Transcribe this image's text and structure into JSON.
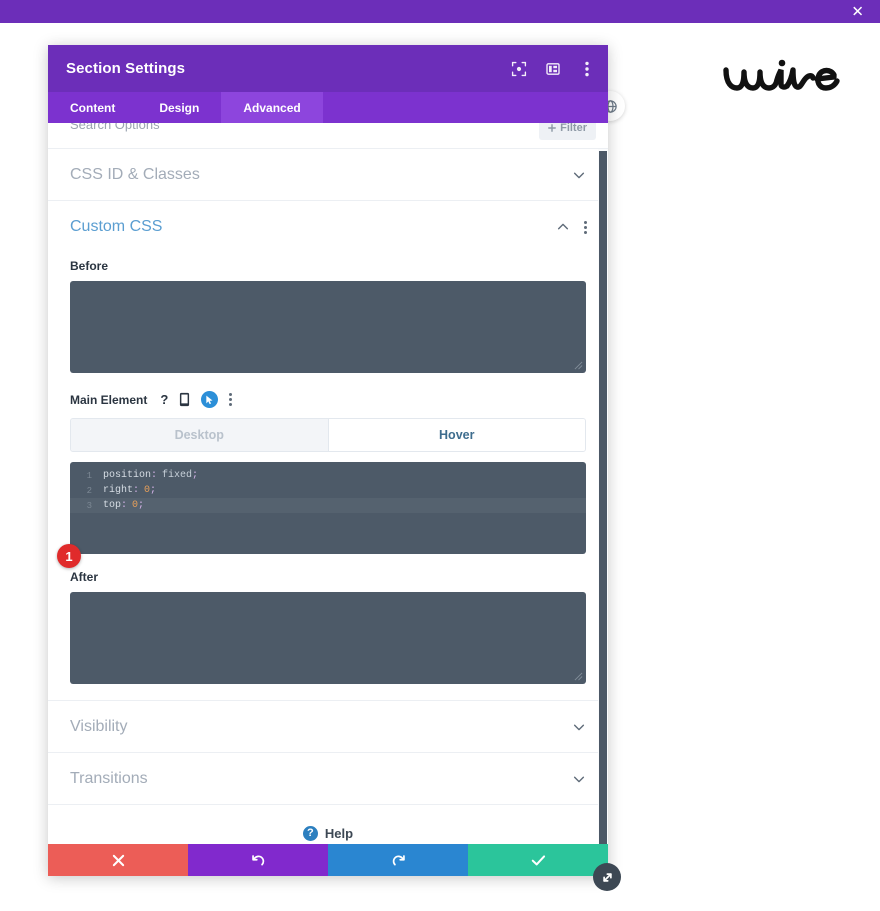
{
  "topbar": {
    "close_label": "✕",
    "background": "#6c2eb9"
  },
  "brand": {
    "logo_text": "wire"
  },
  "modal": {
    "title": "Section Settings",
    "header_icons": [
      {
        "name": "focus-target-icon",
        "label": "focus"
      },
      {
        "name": "layout-panel-icon",
        "label": "layout"
      },
      {
        "name": "more-vertical-icon",
        "label": "more"
      }
    ],
    "tabs": [
      {
        "label": "Content",
        "active": false
      },
      {
        "label": "Design",
        "active": false
      },
      {
        "label": "Advanced",
        "active": true
      }
    ],
    "search": {
      "placeholder": "Search Options",
      "filter_label": "Filter"
    },
    "sections": [
      {
        "label": "CSS ID & Classes",
        "expanded": false
      },
      {
        "label": "Custom CSS",
        "expanded": true
      },
      {
        "label": "Visibility",
        "expanded": false
      },
      {
        "label": "Transitions",
        "expanded": false
      }
    ],
    "custom_css": {
      "title": "Custom CSS",
      "before_label": "Before",
      "before_value": "",
      "after_label": "After",
      "after_value": "",
      "main_element_label": "Main Element",
      "state_tabs": [
        {
          "label": "Desktop",
          "active": false
        },
        {
          "label": "Hover",
          "active": true
        }
      ],
      "code_lines": [
        {
          "number": "1",
          "property": "position",
          "colon": ":",
          "value": "fixed",
          "value_type": "keyword",
          "semicolon": ";",
          "highlighted": false
        },
        {
          "number": "2",
          "property": "right",
          "colon": ":",
          "value": "0",
          "value_type": "number",
          "semicolon": ";",
          "highlighted": false
        },
        {
          "number": "3",
          "property": "top",
          "colon": ":",
          "value": "0",
          "value_type": "number",
          "semicolon": ";",
          "highlighted": true
        }
      ]
    },
    "step_badge": "1",
    "help": {
      "icon_glyph": "?",
      "label": "Help"
    },
    "actions": [
      {
        "name": "cancel-button",
        "glyph": "✖",
        "color": "#ec5d57"
      },
      {
        "name": "undo-button",
        "glyph": "↺",
        "color": "#8129cd"
      },
      {
        "name": "redo-button",
        "glyph": "↻",
        "color": "#2a86d1"
      },
      {
        "name": "save-button",
        "glyph": "✔",
        "color": "#2bc59b"
      }
    ]
  },
  "colors": {
    "brand_purple": "#6c2eb9",
    "tab_purple": "#7c32cf",
    "tab_active_purple": "#8d45dd",
    "code_bg": "#4d5a68",
    "badge_red": "#e02b2b",
    "link_blue": "#5b9ed1"
  }
}
